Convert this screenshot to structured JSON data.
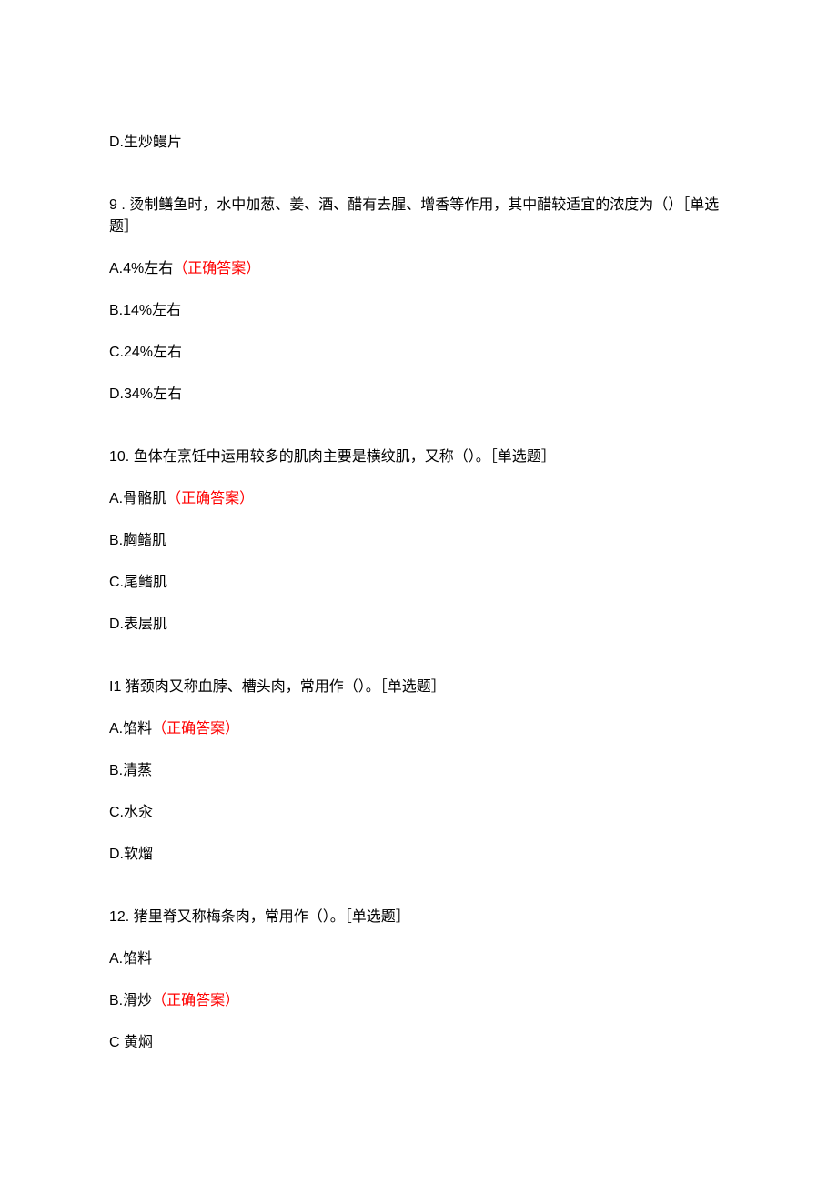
{
  "q8_d": "D.生炒鳗片",
  "q9": {
    "stem": "9 . 烫制鳝鱼时，水中加葱、姜、酒、醋有去腥、增香等作用，其中醋较适宜的浓度为（）［单选题］",
    "a_text": "A.4%左右",
    "a_correct": "（正确答案）",
    "b": "B.14%左右",
    "c": "C.24%左右",
    "d": "D.34%左右"
  },
  "q10": {
    "stem": "10. 鱼体在烹饪中运用较多的肌肉主要是横纹肌，又称（）。［单选题］",
    "a_text": "A.骨骼肌",
    "a_correct": "（正确答案）",
    "b": "B.胸鳍肌",
    "c": "C.尾鳍肌",
    "d": "D.表层肌"
  },
  "q11": {
    "stem": "I1 猪颈肉又称血脖、槽头肉，常用作（）。［单选题］",
    "a_text": "A.馅料",
    "a_correct": "（正确答案）",
    "b": "B.清蒸",
    "c": "C.水汆",
    "d": "D.软熘"
  },
  "q12": {
    "stem": "12. 猪里脊又称梅条肉，常用作（）。［单选题］",
    "a": "A.馅料",
    "b_text": "B.滑炒",
    "b_correct": "（正确答案）",
    "c": "C 黄焖"
  }
}
